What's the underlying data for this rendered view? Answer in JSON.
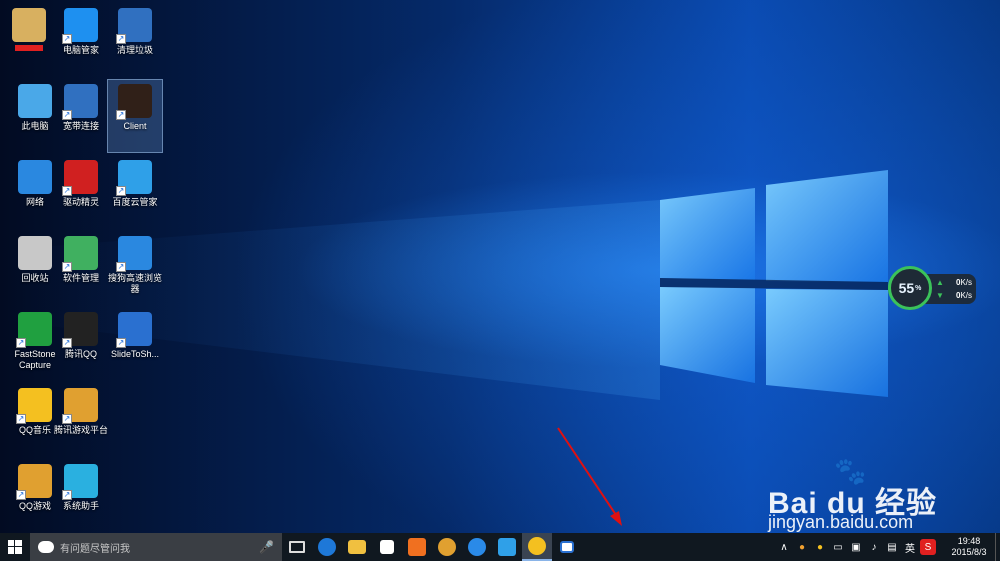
{
  "desktop": {
    "icons": [
      {
        "label": "",
        "icon": "user-folder-icon"
      },
      {
        "label": "电脑管家",
        "icon": "shield-icon"
      },
      {
        "label": "清理垃圾",
        "icon": "broom-icon"
      },
      {
        "label": "此电脑",
        "icon": "computer-icon"
      },
      {
        "label": "宽带连接",
        "icon": "network-connection-icon"
      },
      {
        "label": "Client",
        "icon": "client-app-icon"
      },
      {
        "label": "网络",
        "icon": "network-globe-icon"
      },
      {
        "label": "驱动精灵",
        "icon": "driver-genius-icon"
      },
      {
        "label": "百度云管家",
        "icon": "baidu-cloud-icon"
      },
      {
        "label": "回收站",
        "icon": "recycle-bin-icon"
      },
      {
        "label": "软件管理",
        "icon": "software-manager-icon"
      },
      {
        "label": "搜狗高速浏览器",
        "icon": "sogou-browser-icon"
      },
      {
        "label": "FastStone Capture",
        "icon": "faststone-icon"
      },
      {
        "label": "腾讯QQ",
        "icon": "qq-penguin-icon"
      },
      {
        "label": "SlideToSh...",
        "icon": "slide-to-shutdown-icon"
      },
      {
        "label": "QQ音乐",
        "icon": "qq-music-icon"
      },
      {
        "label": "腾讯游戏平台",
        "icon": "tencent-games-icon"
      },
      {
        "label": "QQ游戏",
        "icon": "qq-game-icon"
      },
      {
        "label": "系统助手",
        "icon": "system-assistant-icon"
      }
    ]
  },
  "net_widget": {
    "percent": "55",
    "percent_unit": "%",
    "up": "0",
    "up_unit": "K/s",
    "down": "0",
    "down_unit": "K/s",
    "percent_value": 0.55
  },
  "watermark": {
    "brand": "Bai du 经验",
    "url": "jingyan.baidu.com"
  },
  "taskbar": {
    "search_placeholder": "有问题尽管问我",
    "apps": [
      "task-view-icon",
      "edge-icon",
      "file-explorer-icon",
      "store-icon",
      "media-player-icon",
      "game-icon",
      "sogou-icon",
      "baidu-cloud-icon",
      "qq-music-icon",
      "slide-to-shutdown-icon"
    ],
    "tray": {
      "ime": "英",
      "time": "19:48",
      "date": "2015/8/3"
    }
  },
  "colors": {
    "taskbar": "#101820",
    "search_box": "#3a3e44",
    "annotation_arrow": "#e01010",
    "widget_ring": "#3bc25a"
  }
}
